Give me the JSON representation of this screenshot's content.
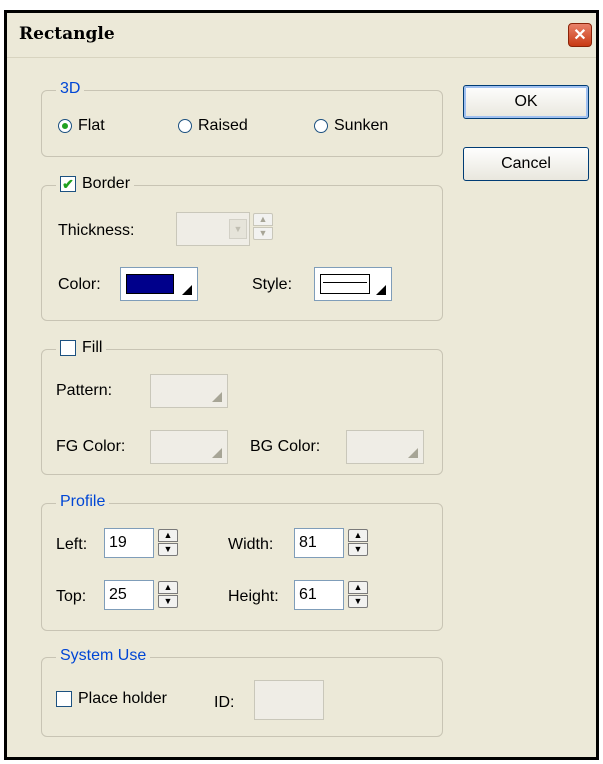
{
  "dialog": {
    "title": "Rectangle",
    "close_glyph": "✕"
  },
  "buttons": {
    "ok_label": "OK",
    "cancel_label": "Cancel"
  },
  "group_3d": {
    "legend": "3D",
    "options": [
      {
        "label": "Flat",
        "selected": true
      },
      {
        "label": "Raised",
        "selected": false
      },
      {
        "label": "Sunken",
        "selected": false
      }
    ]
  },
  "border": {
    "legend": "Border",
    "checked": true,
    "thickness_label": "Thickness:",
    "thickness_value": "",
    "color_label": "Color:",
    "color_value": "#00008b",
    "style_label": "Style:"
  },
  "fill": {
    "legend": "Fill",
    "checked": false,
    "pattern_label": "Pattern:",
    "fg_color_label": "FG Color:",
    "bg_color_label": "BG Color:"
  },
  "profile": {
    "legend": "Profile",
    "left_label": "Left:",
    "left_value": "19",
    "top_label": "Top:",
    "top_value": "25",
    "width_label": "Width:",
    "width_value": "81",
    "height_label": "Height:",
    "height_value": "61"
  },
  "system_use": {
    "legend": "System Use",
    "placeholder_label": "Place holder",
    "placeholder_checked": false,
    "id_label": "ID:",
    "id_value": ""
  },
  "icons": {
    "check_glyph": "✔",
    "up_glyph": "▲",
    "down_glyph": "▼",
    "dropdown_glyph": "▼"
  }
}
